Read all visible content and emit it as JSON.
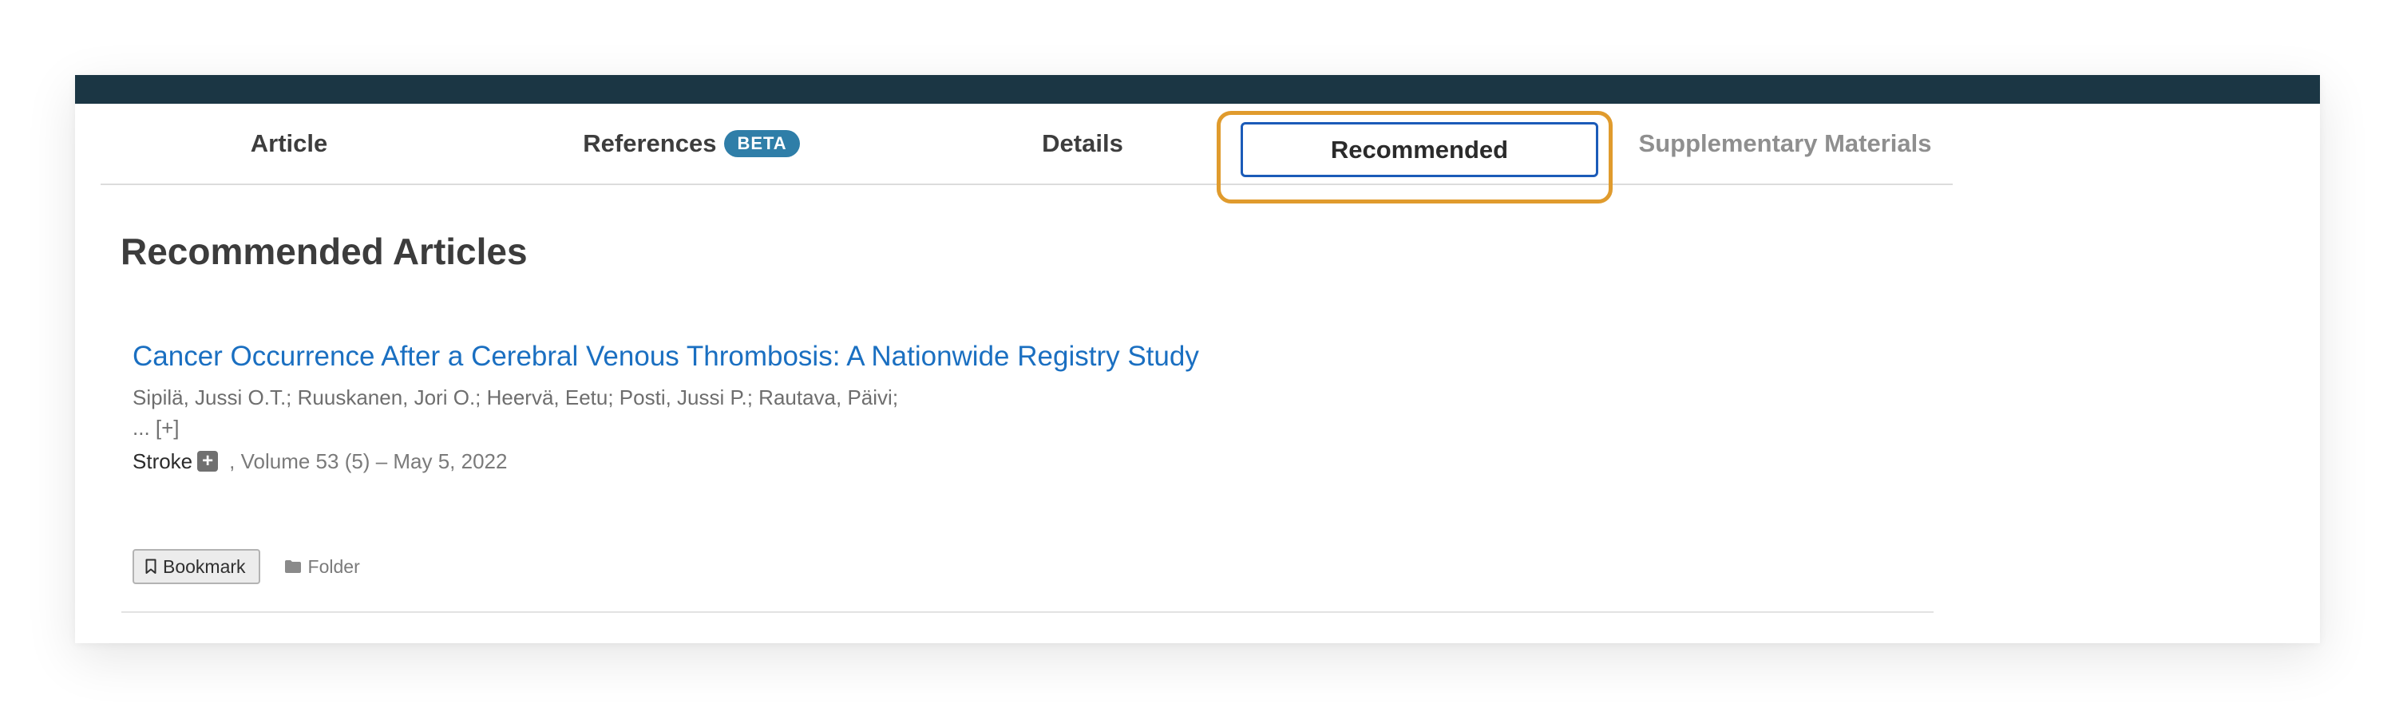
{
  "tabs": {
    "article": "Article",
    "references": "References",
    "references_badge": "BETA",
    "details": "Details",
    "recommended": "Recommended",
    "supplementary": "Supplementary Materials"
  },
  "section": {
    "title": "Recommended Articles"
  },
  "article": {
    "title": "Cancer Occurrence After a Cerebral Venous Thrombosis: A Nationwide Registry Study",
    "authors": "Sipilä, Jussi O.T.; Ruuskanen, Jori O.; Heervä, Eetu; Posti, Jussi P.; Rautava, Päivi;",
    "more": "... [+]",
    "journal": "Stroke",
    "journal_icon": "plus-square-icon",
    "issue": ", Volume 53 (5) – May 5, 2022"
  },
  "actions": {
    "bookmark_label": "Bookmark",
    "folder_label": "Folder"
  },
  "colors": {
    "topbar": "#1b3644",
    "link": "#1a6fc1",
    "badge": "#2f7ea8",
    "focus_ring": "#e09b2d",
    "active_tab_border": "#1b5bb8"
  }
}
